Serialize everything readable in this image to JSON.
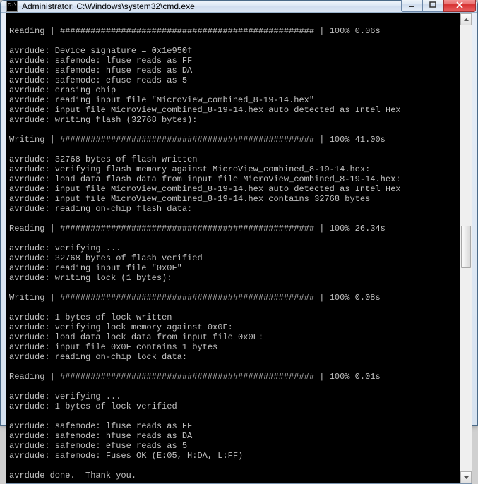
{
  "window": {
    "title": "Administrator: C:\\Windows\\system32\\cmd.exe"
  },
  "console": {
    "lines": [
      "",
      "Reading | ################################################## | 100% 0.06s",
      "",
      "avrdude: Device signature = 0x1e950f",
      "avrdude: safemode: lfuse reads as FF",
      "avrdude: safemode: hfuse reads as DA",
      "avrdude: safemode: efuse reads as 5",
      "avrdude: erasing chip",
      "avrdude: reading input file \"MicroView_combined_8-19-14.hex\"",
      "avrdude: input file MicroView_combined_8-19-14.hex auto detected as Intel Hex",
      "avrdude: writing flash (32768 bytes):",
      "",
      "Writing | ################################################## | 100% 41.00s",
      "",
      "avrdude: 32768 bytes of flash written",
      "avrdude: verifying flash memory against MicroView_combined_8-19-14.hex:",
      "avrdude: load data flash data from input file MicroView_combined_8-19-14.hex:",
      "avrdude: input file MicroView_combined_8-19-14.hex auto detected as Intel Hex",
      "avrdude: input file MicroView_combined_8-19-14.hex contains 32768 bytes",
      "avrdude: reading on-chip flash data:",
      "",
      "Reading | ################################################## | 100% 26.34s",
      "",
      "avrdude: verifying ...",
      "avrdude: 32768 bytes of flash verified",
      "avrdude: reading input file \"0x0F\"",
      "avrdude: writing lock (1 bytes):",
      "",
      "Writing | ################################################## | 100% 0.08s",
      "",
      "avrdude: 1 bytes of lock written",
      "avrdude: verifying lock memory against 0x0F:",
      "avrdude: load data lock data from input file 0x0F:",
      "avrdude: input file 0x0F contains 1 bytes",
      "avrdude: reading on-chip lock data:",
      "",
      "Reading | ################################################## | 100% 0.01s",
      "",
      "avrdude: verifying ...",
      "avrdude: 1 bytes of lock verified",
      "",
      "avrdude: safemode: lfuse reads as FF",
      "avrdude: safemode: hfuse reads as DA",
      "avrdude: safemode: efuse reads as 5",
      "avrdude: safemode: Fuses OK (E:05, H:DA, L:FF)",
      "",
      "avrdude done.  Thank you.",
      ""
    ]
  }
}
